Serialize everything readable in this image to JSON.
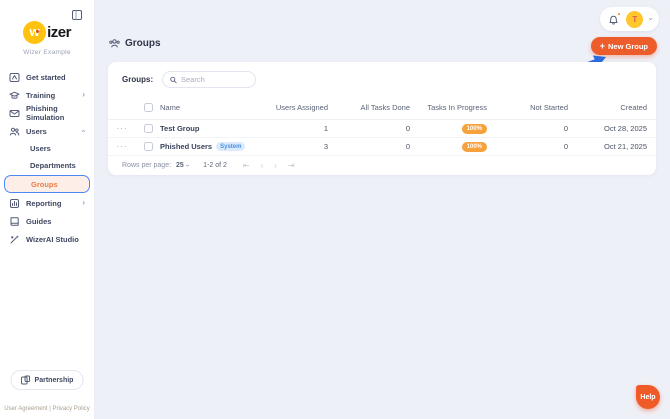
{
  "colors": {
    "accent_orange": "#ED5C2B",
    "badge_orange": "#F6A13B",
    "active_nav_bg": "#FDEFE7",
    "active_nav_border": "#4F86F7",
    "active_nav_text": "#EE7C45",
    "avatar_bg": "#FFC72C",
    "avatar_text": "#E2574C",
    "system_badge_bg": "#DCEBFC",
    "system_badge_text": "#4A90E2",
    "arrow_blue": "#2D6CE0",
    "main_bg": "#EEF0F8",
    "logo_yellow": "#FFC20E"
  },
  "sidebar": {
    "logo_glyph": "w",
    "logo_suffix": "izer",
    "workspace_name": "Wizer Example",
    "items": [
      {
        "label": "Get started"
      },
      {
        "label": "Training",
        "chevron": "right"
      },
      {
        "label": "Phishing Simulation"
      },
      {
        "label": "Users",
        "chevron": "up"
      },
      {
        "label": "Reporting",
        "chevron": "right"
      },
      {
        "label": "Guides"
      },
      {
        "label": "WizerAI Studio"
      }
    ],
    "users_submenu": [
      {
        "label": "Users"
      },
      {
        "label": "Departments"
      },
      {
        "label": "Groups",
        "active": true
      }
    ],
    "partnership_label": "Partnership",
    "legal": {
      "user_agreement": "User Agreement",
      "divider": "|",
      "privacy_policy": "Privacy Policy"
    }
  },
  "header": {
    "title": "Groups",
    "plus_glyph": "+",
    "new_group_label": "New Group",
    "avatar_initial": "T"
  },
  "groups_panel": {
    "filter_label": "Groups:",
    "search_placeholder": "Search",
    "table": {
      "columns": [
        "Name",
        "Users Assigned",
        "All Tasks Done",
        "Tasks In Progress",
        "Not Started",
        "Created"
      ],
      "rows": [
        {
          "name": "Test Group",
          "users_assigned": "1",
          "all_tasks_done": "0",
          "tasks_in_progress": "100%",
          "not_started": "0",
          "created": "Oct 28, 2025"
        },
        {
          "name": "Phished Users",
          "system_badge": "System",
          "users_assigned": "3",
          "all_tasks_done": "0",
          "tasks_in_progress": "100%",
          "not_started": "0",
          "created": "Oct 21, 2025"
        }
      ]
    },
    "pagination": {
      "rows_per_page_label": "Rows per page:",
      "rows_per_page_value": "25",
      "range_label": "1-2 of 2",
      "first_glyph": "⇤",
      "prev_glyph": "‹",
      "next_glyph": "›",
      "last_glyph": "⇥"
    }
  },
  "icons": {
    "row_menu_glyph": "···",
    "chevron_glyph": "›"
  },
  "help": {
    "label": "Help"
  }
}
